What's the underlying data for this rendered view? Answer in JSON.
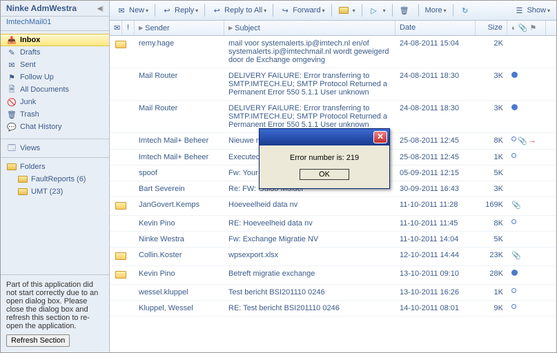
{
  "sidebar": {
    "title": "Ninke AdmWestra",
    "subtitle": "ImtechMail01",
    "items": [
      {
        "label": "Inbox",
        "icon": "📥",
        "selected": true
      },
      {
        "label": "Drafts",
        "icon": "✎"
      },
      {
        "label": "Sent",
        "icon": "✉"
      },
      {
        "label": "Follow Up",
        "icon": "⚑"
      },
      {
        "label": "All Documents",
        "icon": "🗎"
      },
      {
        "label": "Junk",
        "icon": "🚫"
      },
      {
        "label": "Trash",
        "icon": "🗑"
      },
      {
        "label": "Chat History",
        "icon": "💬"
      }
    ],
    "views_label": "Views",
    "folders_label": "Folders",
    "subfolders": [
      {
        "label": "FaultReports (6)"
      },
      {
        "label": "UMT (23)"
      }
    ],
    "error": {
      "text": "Part of this application did not start correctly due to an open dialog box. Please close the dialog box and refresh this section to re-open the application.",
      "button": "Refresh Section"
    }
  },
  "toolbar": {
    "new": "New",
    "reply": "Reply",
    "reply_all": "Reply to All",
    "forward": "Forward",
    "more": "More",
    "show": "Show"
  },
  "grid": {
    "headers": {
      "sender": "Sender",
      "subject": "Subject",
      "date": "Date",
      "size": "Size"
    },
    "rows": [
      {
        "env": true,
        "sender": "remy.hage",
        "subject": "mail voor systemalerts.ip@imtech.nl en/of systemalerts.ip@imtechmail.nl wordt geweigerd door de Exchange omgeving",
        "date": "24-08-2011 15:04",
        "size": "2K",
        "flags": []
      },
      {
        "env": false,
        "sender": "Mail Router",
        "subject": "DELIVERY FAILURE: Error transferring to SMTP.IMTECH.EU; SMTP Protocol Returned a Permanent Error 550 5.1.1 User unknown",
        "date": "24-08-2011 18:30",
        "size": "3K",
        "flags": [
          "blue"
        ]
      },
      {
        "env": false,
        "sender": "Mail Router",
        "subject": "DELIVERY FAILURE: Error transferring to SMTP.IMTECH.EU; SMTP Protocol Returned a Permanent Error 550 5.1.1 User unknown",
        "date": "24-08-2011 18:30",
        "size": "3K",
        "flags": [
          "blue"
        ]
      },
      {
        "env": false,
        "sender": "Imtech Mail+ Beheer",
        "subject": "Nieuwe medewerker op ADMPiet Vernon",
        "date": "25-08-2011 12:45",
        "size": "8K",
        "flags": [
          "hollow",
          "clip",
          "arrow"
        ]
      },
      {
        "env": false,
        "sender": "Imtech Mail+ Beheer",
        "subject": "Executed ...",
        "date": "25-08-2011 12:45",
        "size": "1K",
        "flags": [
          "hollow"
        ]
      },
      {
        "env": false,
        "sender": "spoof",
        "subject": "Fw: Your paypal account has been limited",
        "date": "05-09-2011 12:15",
        "size": "5K",
        "flags": []
      },
      {
        "env": false,
        "sender": "Bart Severein",
        "subject": "Re: FW: Guido Mulder",
        "date": "30-09-2011 16:43",
        "size": "3K",
        "flags": []
      },
      {
        "env": true,
        "sender": "JanGovert.Kemps",
        "subject": "Hoeveelheid data nv",
        "date": "11-10-2011 11:28",
        "size": "169K",
        "flags": [
          "clip"
        ]
      },
      {
        "env": false,
        "sender": "Kevin Pino",
        "subject": "RE: Hoeveelheid data nv",
        "date": "11-10-2011 11:45",
        "size": "8K",
        "flags": [
          "hollow"
        ]
      },
      {
        "env": false,
        "sender": "Ninke Westra",
        "subject": "Fw: Exchange Migratie NV",
        "date": "11-10-2011 14:04",
        "size": "5K",
        "flags": []
      },
      {
        "env": true,
        "sender": "Collin.Koster",
        "subject": "wpsexport.xlsx",
        "date": "12-10-2011 14:44",
        "size": "23K",
        "flags": [
          "clip"
        ]
      },
      {
        "env": true,
        "sender": "Kevin Pino",
        "subject": "Betreft migratie exchange",
        "date": "13-10-2011 09:10",
        "size": "28K",
        "flags": [
          "blue"
        ]
      },
      {
        "env": false,
        "sender": "wessel.kluppel",
        "subject": "Test bericht BSI201110 0246",
        "date": "13-10-2011 16:26",
        "size": "1K",
        "flags": [
          "hollow"
        ]
      },
      {
        "env": false,
        "sender": "Kluppel, Wessel",
        "subject": "RE: Test bericht BSI201110 0246",
        "date": "14-10-2011 08:01",
        "size": "9K",
        "flags": [
          "hollow"
        ]
      }
    ]
  },
  "dialog": {
    "message": "Error number is: 219",
    "ok": "OK"
  }
}
